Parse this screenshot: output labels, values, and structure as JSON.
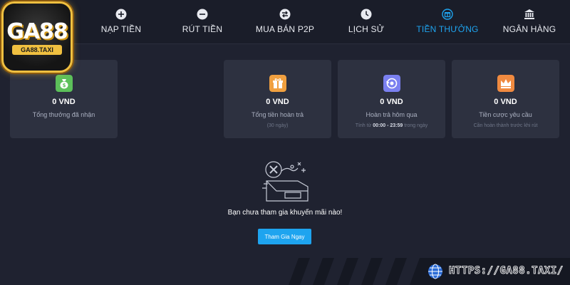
{
  "logo": {
    "brand": "GA88",
    "site": "GA88.TAXI"
  },
  "nav": {
    "items": [
      {
        "label": "NẠP TIỀN",
        "icon": "plus-circle-icon"
      },
      {
        "label": "RÚT TIỀN",
        "icon": "minus-circle-icon"
      },
      {
        "label": "MUA BÁN P2P",
        "icon": "exchange-icon"
      },
      {
        "label": "LỊCH SỬ",
        "icon": "clock-icon"
      },
      {
        "label": "TIỀN THƯỞNG",
        "icon": "gift-icon",
        "active": true
      },
      {
        "label": "NGÂN HÀNG",
        "icon": "bank-icon"
      }
    ]
  },
  "cards": [
    {
      "value": "0 VND",
      "label": "Tổng thưởng đã nhận",
      "icon": "money-bag-icon",
      "color": "#5cc05a"
    },
    {
      "value": "0 VND",
      "label": "Tổng tiền hoàn trả",
      "sub": "(30 ngày)",
      "icon": "gift-box-icon",
      "color": "#f0a040"
    },
    {
      "value": "0 VND",
      "label": "Hoàn trả hôm qua",
      "sub_prefix": "Tính từ",
      "sub_time": "00:00 - 23:59",
      "sub_suffix": "trong ngày",
      "icon": "refund-icon",
      "color": "#7a80f0"
    },
    {
      "value": "0 VND",
      "label": "Tiền cược yêu cầu",
      "sub": "Cần hoàn thành trước khi rút",
      "icon": "crown-icon",
      "color": "#f08a40"
    }
  ],
  "empty": {
    "message": "Bạn chưa tham gia khuyến mãi nào!",
    "button": "Tham Gia Ngay"
  },
  "footer": {
    "url": "HTTPS://GA88.TAXI/"
  },
  "colors": {
    "accent": "#1ea4ef",
    "background": "#1f2230",
    "card": "#2d3140"
  }
}
